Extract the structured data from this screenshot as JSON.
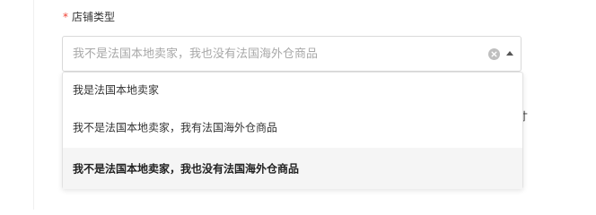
{
  "field": {
    "required_mark": "*",
    "label": "店铺类型"
  },
  "select": {
    "value": "我不是法国本地卖家，我也没有法国海外仓商品",
    "clear_icon": "clear-circle-icon",
    "arrow_icon": "caret-up-icon"
  },
  "options": [
    {
      "label": "我是法国本地卖家"
    },
    {
      "label": "我不是法国本地卖家，我有法国海外仓商品"
    },
    {
      "label": "我不是法国本地卖家，我也没有法国海外仓商品",
      "selected": true
    }
  ],
  "background": {
    "partial_text": "寸"
  },
  "colors": {
    "required": "#f04134",
    "placeholder": "#a8a8a8",
    "selected_bg": "#f5f5f5"
  }
}
